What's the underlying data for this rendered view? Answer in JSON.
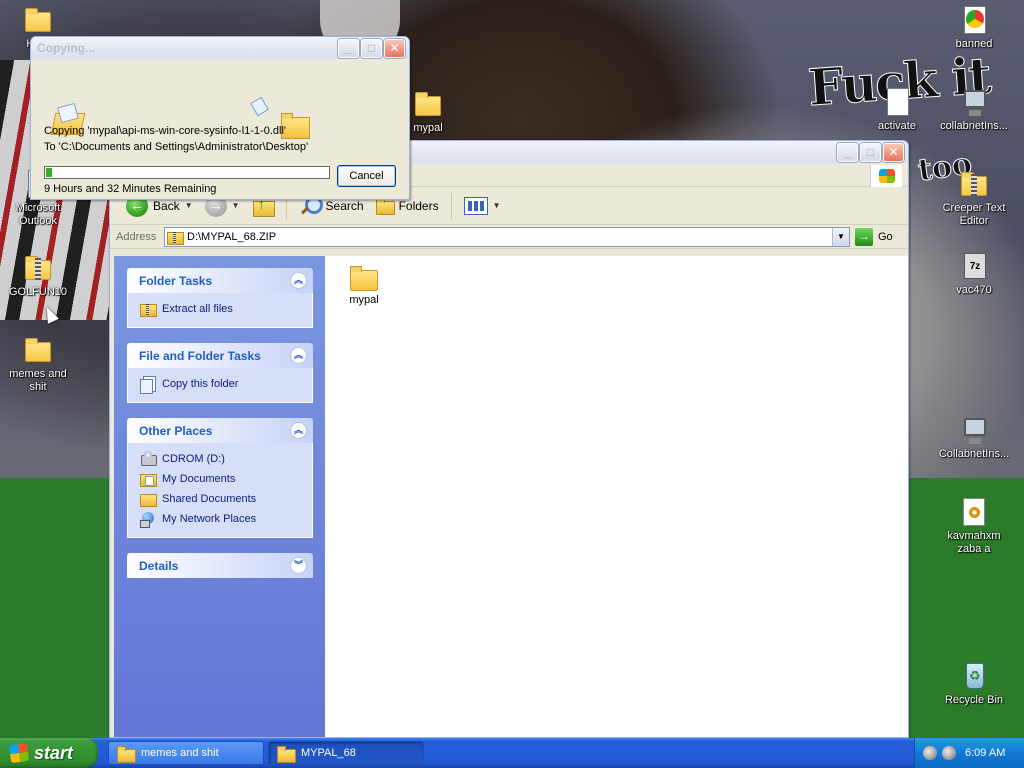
{
  "desktop": {
    "wallpaper_text_1": "Fuck it",
    "wallpaper_text_2": "too",
    "icons": {
      "top_folder": "Hom",
      "golfun": "GOLFUN10",
      "outlook": "Microsoft Outlook",
      "memes": "memes and shit",
      "mypal": "mypal",
      "activate": "activate",
      "banned": "banned",
      "collabnet1": "collabnetIns...",
      "creeper": "Creeper Text Editor",
      "vac": "vac470",
      "collabnet2": "CollabnetIns...",
      "kavmahxm": "kavmahxm zaba a",
      "recycle": "Recycle Bin"
    }
  },
  "copy_dialog": {
    "title": "Copying...",
    "copy_line": "Copying 'mypal\\api-ms-win-core-sysinfo-l1-1-0.dll'",
    "to_line": "To 'C:\\Documents and Settings\\Administrator\\Desktop'",
    "progress_fraction": 0.02,
    "remaining": "9 Hours and 32 Minutes Remaining",
    "cancel_label": "Cancel"
  },
  "explorer": {
    "toolbar": {
      "back_label": "Back",
      "search_label": "Search",
      "folders_label": "Folders"
    },
    "address": {
      "label": "Address",
      "value": "D:\\MYPAL_68.ZIP",
      "go_label": "Go"
    },
    "tasks": {
      "folder_tasks": {
        "title": "Folder Tasks",
        "items": [
          "Extract all files"
        ]
      },
      "file_folder_tasks": {
        "title": "File and Folder Tasks",
        "items": [
          "Copy this folder"
        ]
      },
      "other_places": {
        "title": "Other Places",
        "items": [
          "CDROM (D:)",
          "My Documents",
          "Shared Documents",
          "My Network Places"
        ]
      },
      "details": {
        "title": "Details"
      }
    },
    "files": [
      {
        "name": "mypal",
        "icon": "folder-icon"
      }
    ]
  },
  "taskbar": {
    "start_label": "start",
    "buttons": [
      "memes and shit",
      "MYPAL_68"
    ],
    "clock": "6:09 AM"
  }
}
